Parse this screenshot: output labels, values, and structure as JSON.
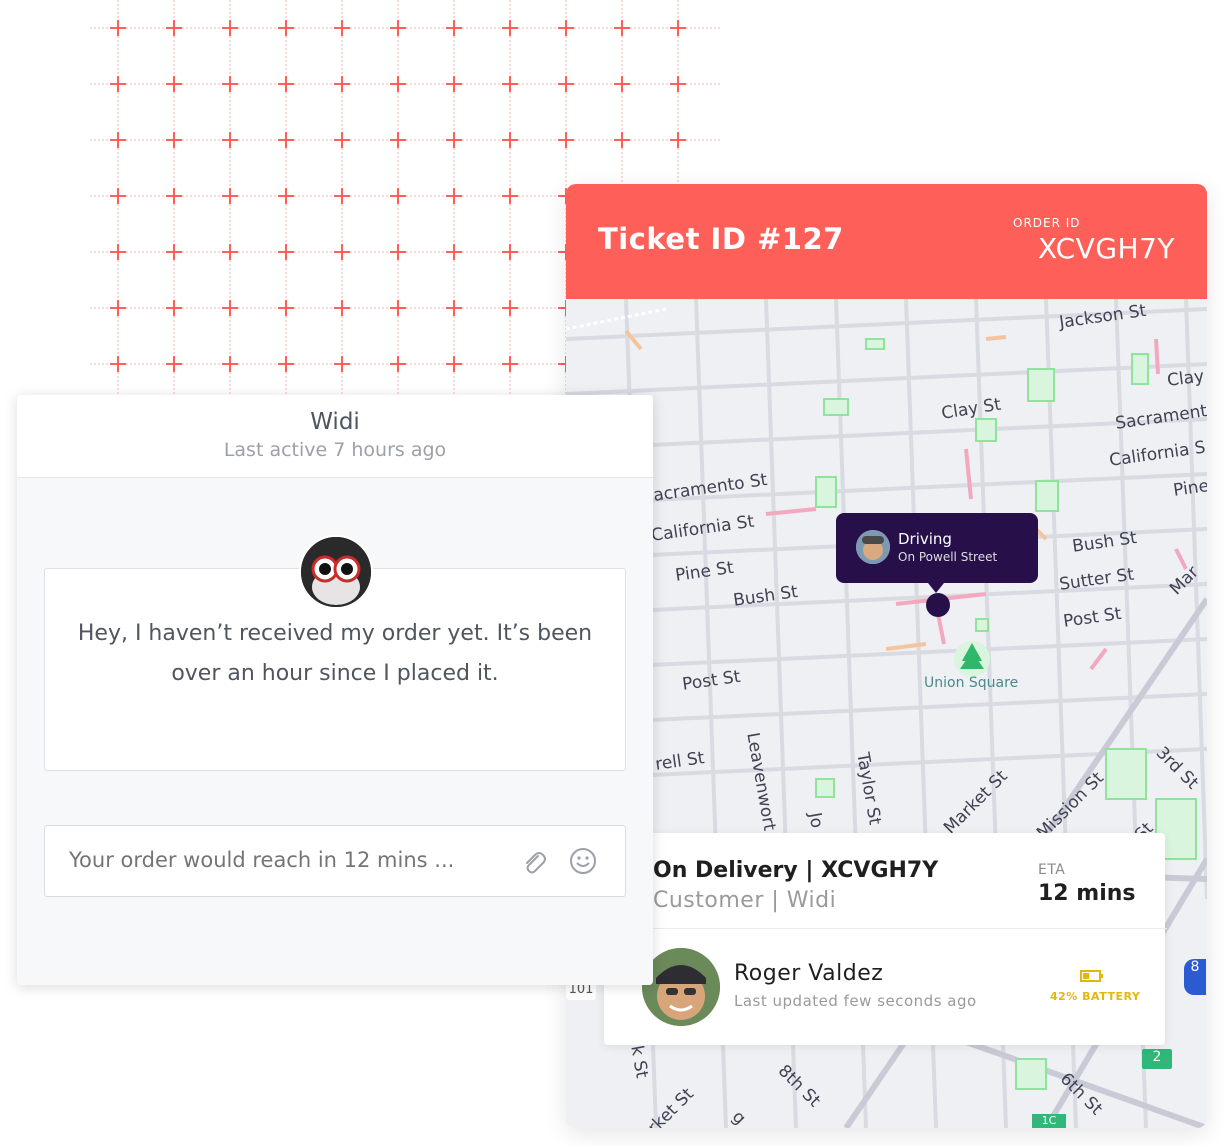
{
  "ticket": {
    "title": "Ticket ID #127",
    "order_label": "ORDER ID",
    "order_id": "XCVGH7Y",
    "header_color": "#fe5f59"
  },
  "map": {
    "streets": [
      "Jackson St",
      "Clay",
      "Clay St",
      "Sacrament",
      "California S",
      "Pine",
      "acramento St",
      "California St",
      "Pine St",
      "Bush St",
      "Bush St",
      "Sutter St",
      "Post St",
      "Post St",
      "Mar",
      "rell St",
      "Leavenwort",
      "Jo",
      "Taylor St",
      "Market St",
      "Mission St",
      "St",
      "3rd St",
      "k St",
      "rket St",
      "8th St",
      "6th St",
      "g"
    ],
    "poi": "Union Square",
    "highway_labels": [
      "101",
      "2",
      "8",
      "1C"
    ],
    "bubble": {
      "status": "Driving",
      "location": "On Powell Street"
    }
  },
  "delivery": {
    "title": "On Delivery | XCVGH7Y",
    "customer": "Customer | Widi",
    "eta_label": "ETA",
    "eta_value": "12 mins",
    "driver_name": "Roger Valdez",
    "driver_updated": "Last updated few seconds ago",
    "battery_label": "42% BATTERY",
    "battery_level": 0.42,
    "battery_color": "#e3b80c"
  },
  "chat": {
    "name": "Widi",
    "last_active": "Last active 7 hours ago",
    "message": "Hey, I haven’t received my order yet. It’s been over an hour since I placed it.",
    "input_placeholder": "Your order would reach in 12 mins ...",
    "icons": [
      "paperclip-icon",
      "smile-icon"
    ]
  }
}
